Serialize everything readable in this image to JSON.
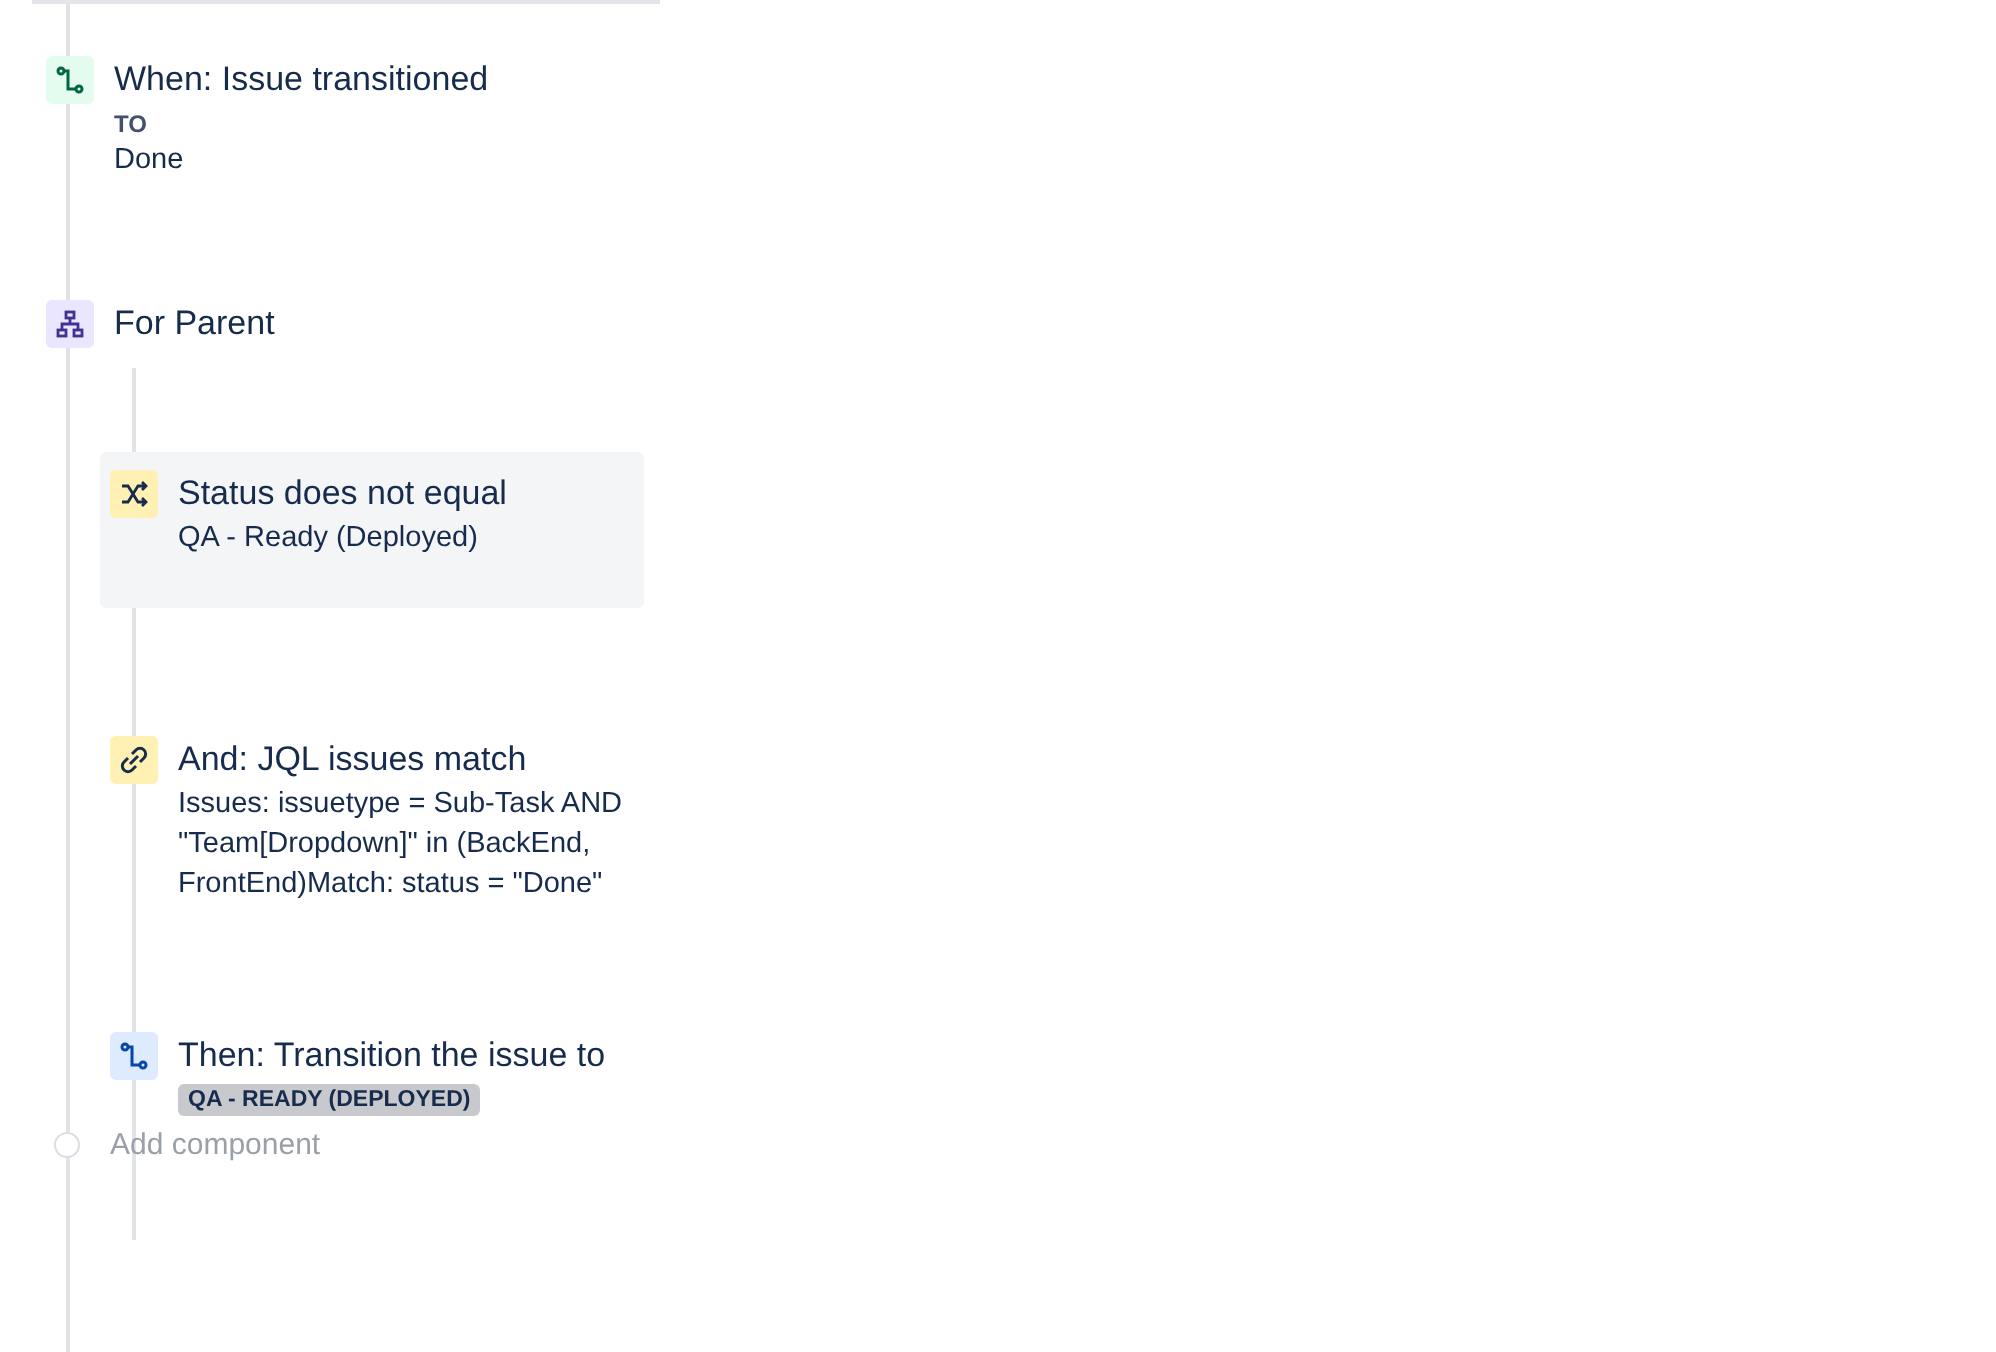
{
  "trigger": {
    "kind": "trigger",
    "title": "When: Issue transitioned",
    "label": "TO",
    "value": "Done"
  },
  "branch": {
    "kind": "branch",
    "title": "For Parent",
    "children": [
      {
        "kind": "condition",
        "selected": true,
        "title": "Status does not equal",
        "detail": "QA - Ready (Deployed)"
      },
      {
        "kind": "link",
        "selected": false,
        "title": "And: JQL issues match",
        "detail": "Issues: issuetype = Sub-Task AND \"Team[Dropdown]\" in (BackEnd, FrontEnd)Match: status = \"Done\""
      },
      {
        "kind": "action",
        "selected": false,
        "title": "Then: Transition the issue to",
        "lozenge": "QA - READY (DEPLOYED)"
      }
    ]
  },
  "add_component": "Add component"
}
